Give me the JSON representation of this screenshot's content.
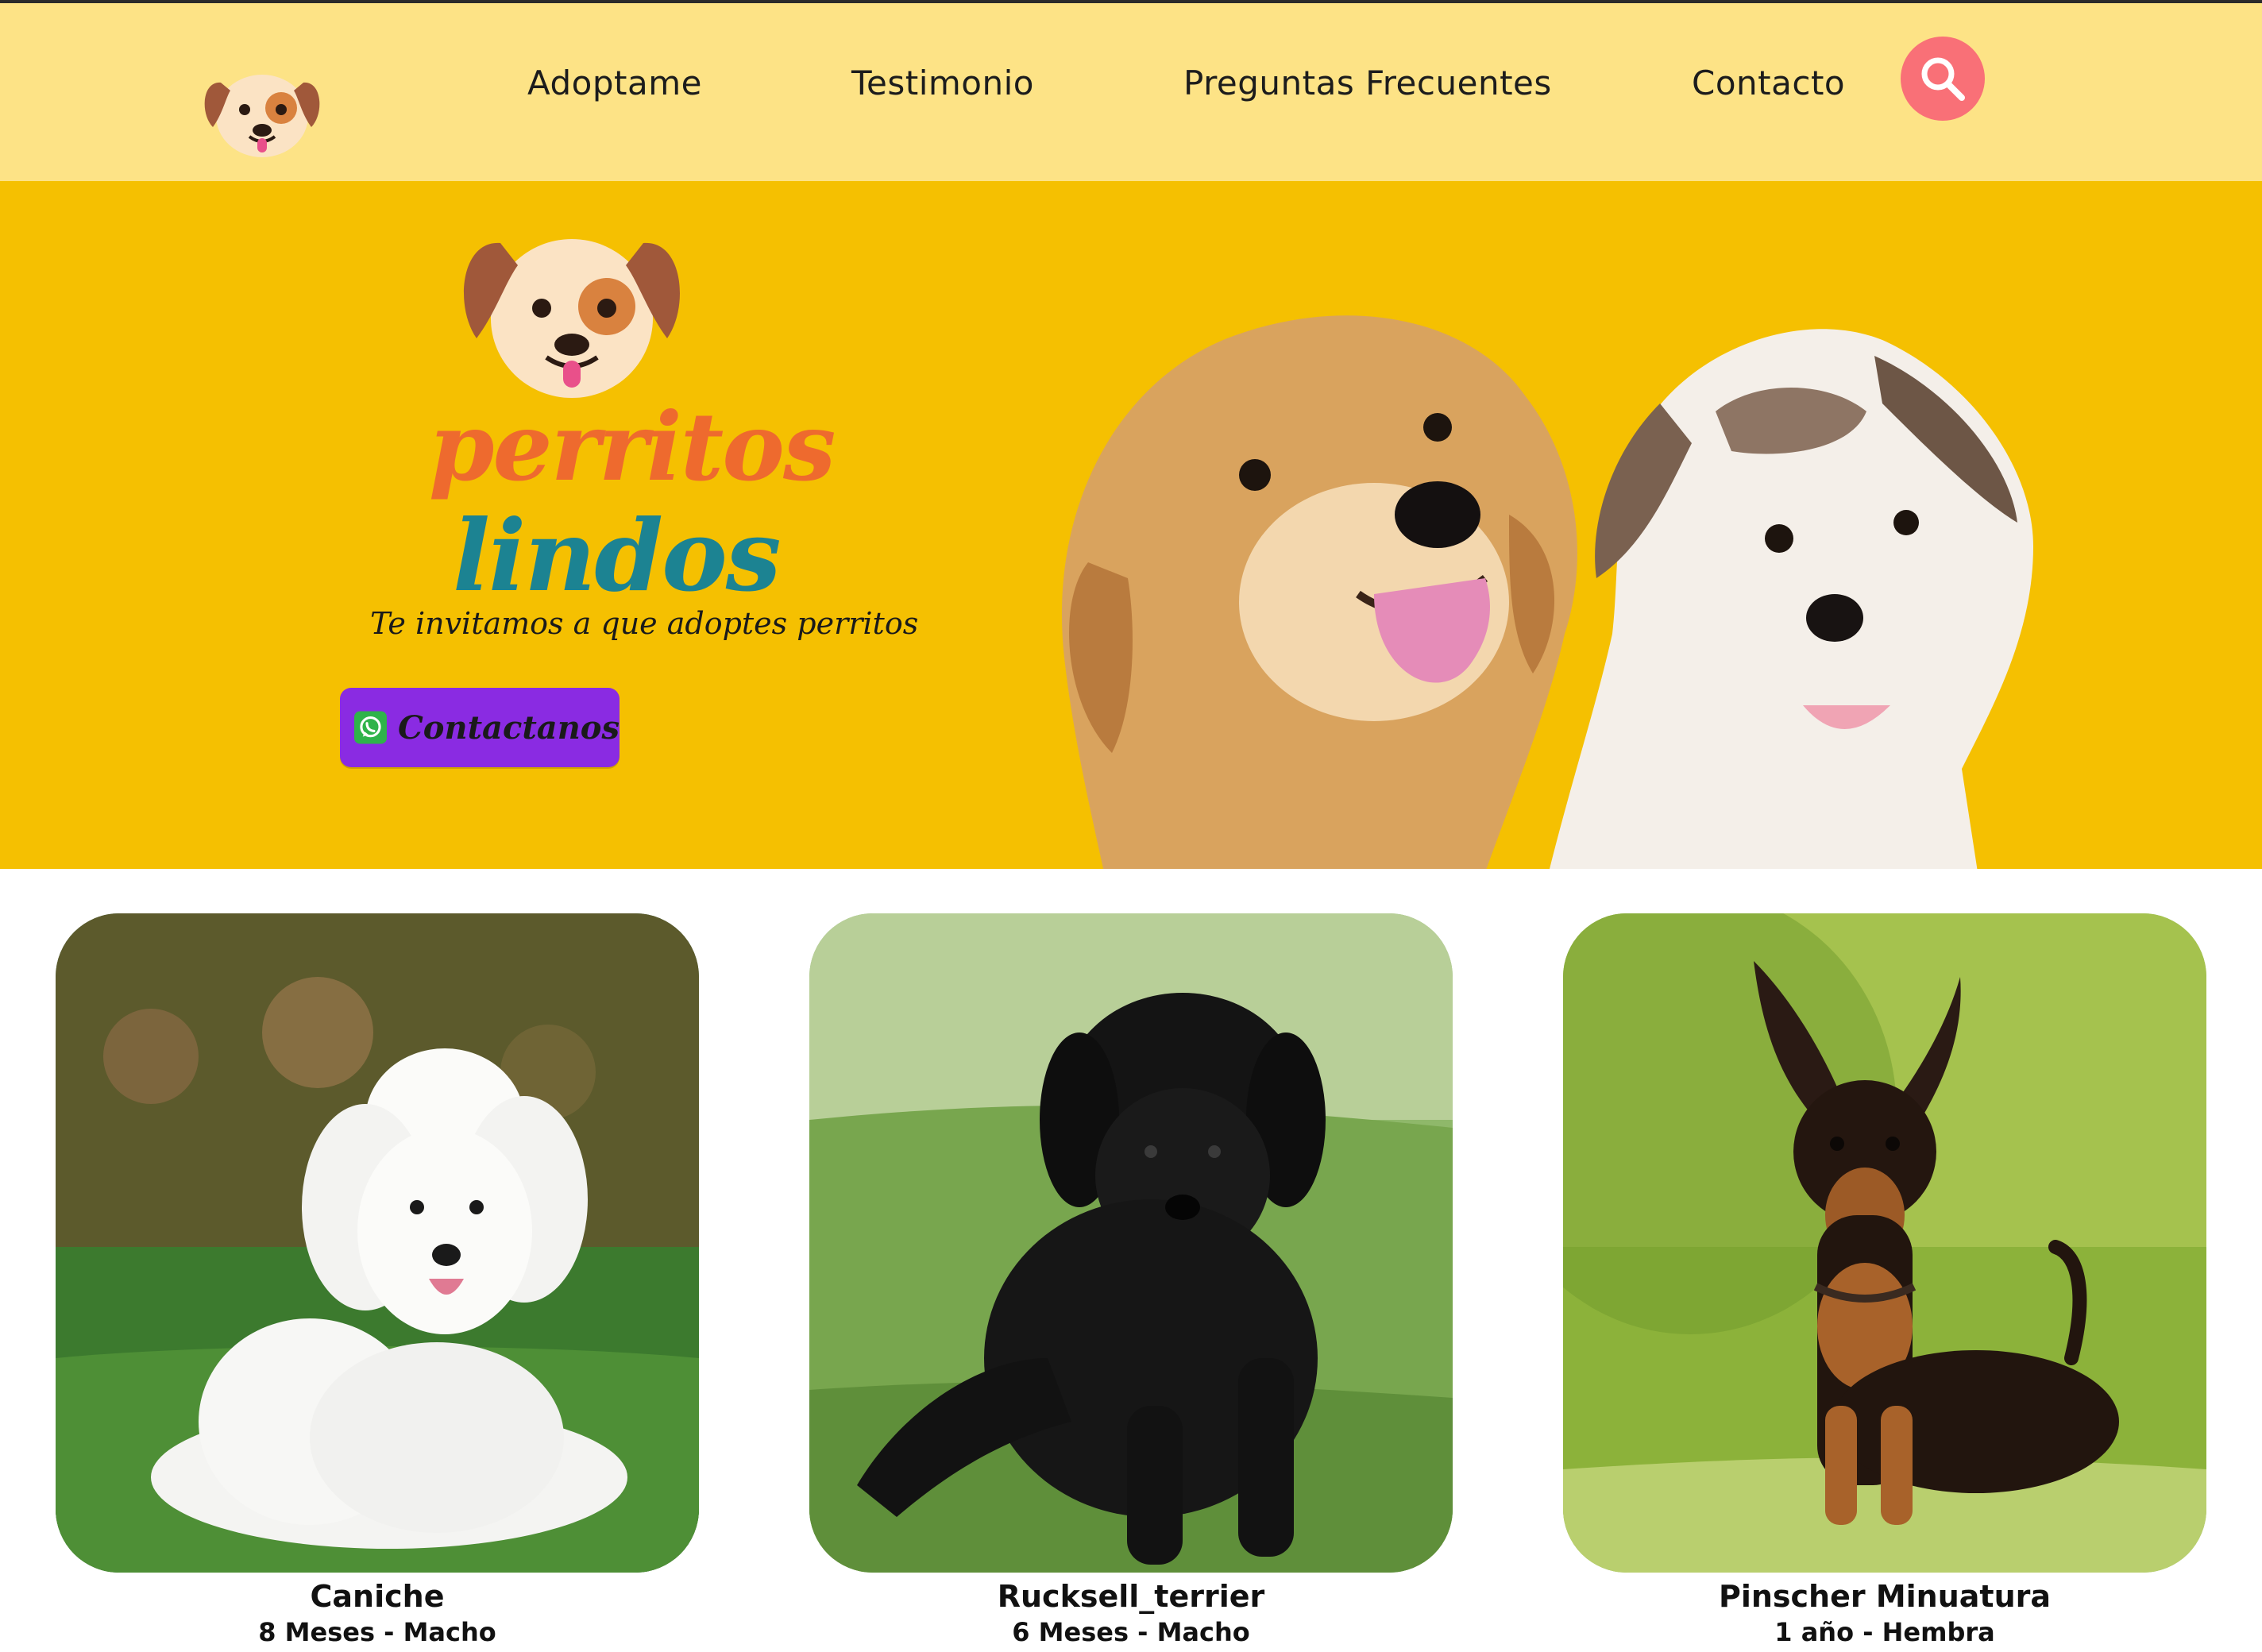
{
  "colors": {
    "header_bg": "#fde386",
    "hero_bg": "#f5c001",
    "search_button": "#f97077",
    "contact_button": "#8a2be2",
    "brand_orange": "#ee6a2e",
    "brand_teal": "#1c8392"
  },
  "header": {
    "logo_icon": "dog-face-icon",
    "nav": [
      "Adoptame",
      "Testimonio",
      "Preguntas Frecuentes",
      "Contacto"
    ],
    "search_icon": "search-icon"
  },
  "hero": {
    "brand_line1": "perritos",
    "brand_line2": "lindos",
    "tagline": "Te invitamos a que adoptes perritos",
    "contact_button": {
      "label": "Contactanos",
      "icon": "whatsapp-icon"
    }
  },
  "pets": [
    {
      "name": "Caniche",
      "info": "8 Meses - Macho"
    },
    {
      "name": "Rucksell_terrier",
      "info": "6 Meses - Macho"
    },
    {
      "name": "Pinscher Minuatura",
      "info": "1 año - Hembra"
    }
  ]
}
